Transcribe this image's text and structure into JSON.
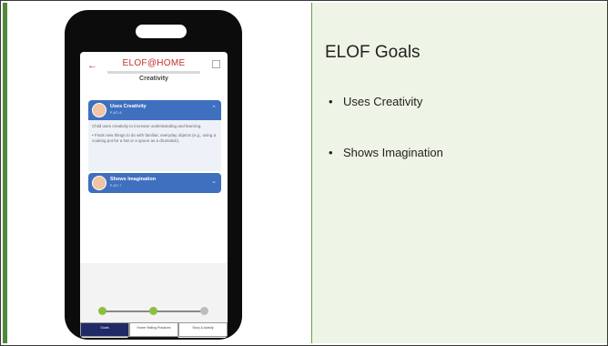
{
  "slide": {
    "title": "ELOF Goals",
    "bullets": [
      "Uses Creativity",
      "Shows Imagination"
    ],
    "accent_color": "#4e8a3a",
    "panel_color": "#eef5e6"
  },
  "phone": {
    "app": {
      "logo": "ELOF@HOME",
      "page_title": "Creativity"
    },
    "goals": [
      {
        "name": "Uses Creativity",
        "code": "P-ATL 6",
        "expanded": true
      },
      {
        "name": "Shows Imagination",
        "code": "P-ATL 7",
        "expanded": false
      }
    ],
    "description": "Child uses creativity to increase understanding and learning.",
    "example": "• Finds new things to do with familiar, everyday objects (e.g., using a cooking pot for a hat or a spoon as a drumstick).",
    "tabs": [
      "Goals",
      "Home Visiting Practices",
      "Story & Activity"
    ],
    "active_tab": 0,
    "colors": {
      "card": "#3f6fbf",
      "tab_active": "#1f2a66",
      "logo": "#c4302b",
      "progress": "#8cbf3f"
    }
  }
}
